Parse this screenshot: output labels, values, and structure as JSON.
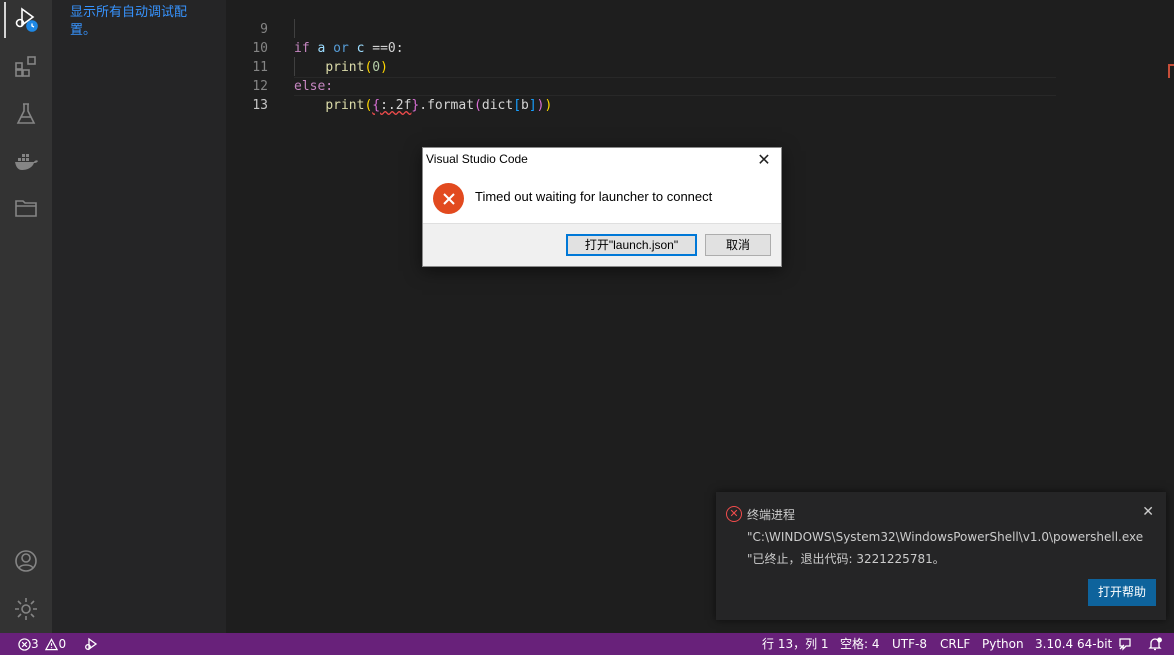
{
  "sidebar": {
    "link_text": "显示所有自动调试配置。"
  },
  "editor": {
    "lines": [
      {
        "number": "9"
      },
      {
        "number": "10"
      },
      {
        "number": "11"
      },
      {
        "number": "12"
      },
      {
        "number": "13"
      }
    ],
    "code": {
      "l9_if": "if",
      "l9_a": "a",
      "l9_or": "or",
      "l9_c": "c",
      "l9_rest": "==0:",
      "l10_print": "print",
      "l10_zero": "0",
      "l11_else": "else:",
      "l12_print": "print",
      "l12_fmt": ":.2f",
      "l12_format": ".format",
      "l12_dict": "dict",
      "l12_b": "b"
    }
  },
  "dialog": {
    "title": "Visual Studio Code",
    "message": "Timed out waiting for launcher to connect",
    "primary_button": "打开\"launch.json\"",
    "cancel_button": "取消"
  },
  "notification": {
    "title": "终端进程",
    "line1": "\"C:\\WINDOWS\\System32\\WindowsPowerShell\\v1.0\\powershell.exe",
    "line2": "\"已终止，退出代码: 3221225781。",
    "help_button": "打开帮助"
  },
  "statusbar": {
    "errors": "3",
    "warnings": "0",
    "position": "行 13，列 1",
    "spaces": "空格: 4",
    "encoding": "UTF-8",
    "eol": "CRLF",
    "language": "Python",
    "interpreter": "3.10.4 64-bit"
  },
  "colors": {
    "statusbar_bg": "#68217a",
    "notification_button": "#0e639c",
    "error_red": "#e24a1f",
    "link_blue": "#3794ff"
  }
}
